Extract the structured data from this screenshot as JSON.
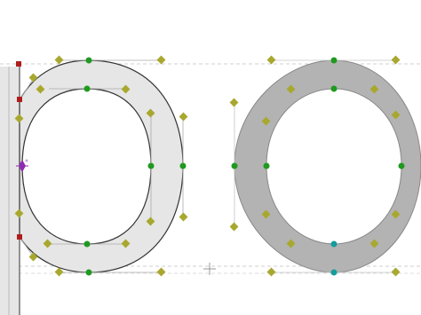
{
  "editor": {
    "view": "glyph-outline-editor",
    "glyphs": [
      {
        "name": "p",
        "state": "selected",
        "fill_color": "#e6e6e6"
      },
      {
        "name": "o",
        "state": "inactive",
        "fill_color": "#b3b3b3"
      }
    ],
    "colors": {
      "canvas_background": "#ffffff",
      "outline_stroke": "#333333",
      "guideline": "#c8c8c8",
      "on_curve_point": "#1f9a1f",
      "off_curve_handle": "#a8a830",
      "corner_point": "#b01c1c",
      "start_point": "#8e2bb0",
      "selected_point": "#159c9c",
      "handle_line": "#aaaaaa"
    }
  }
}
